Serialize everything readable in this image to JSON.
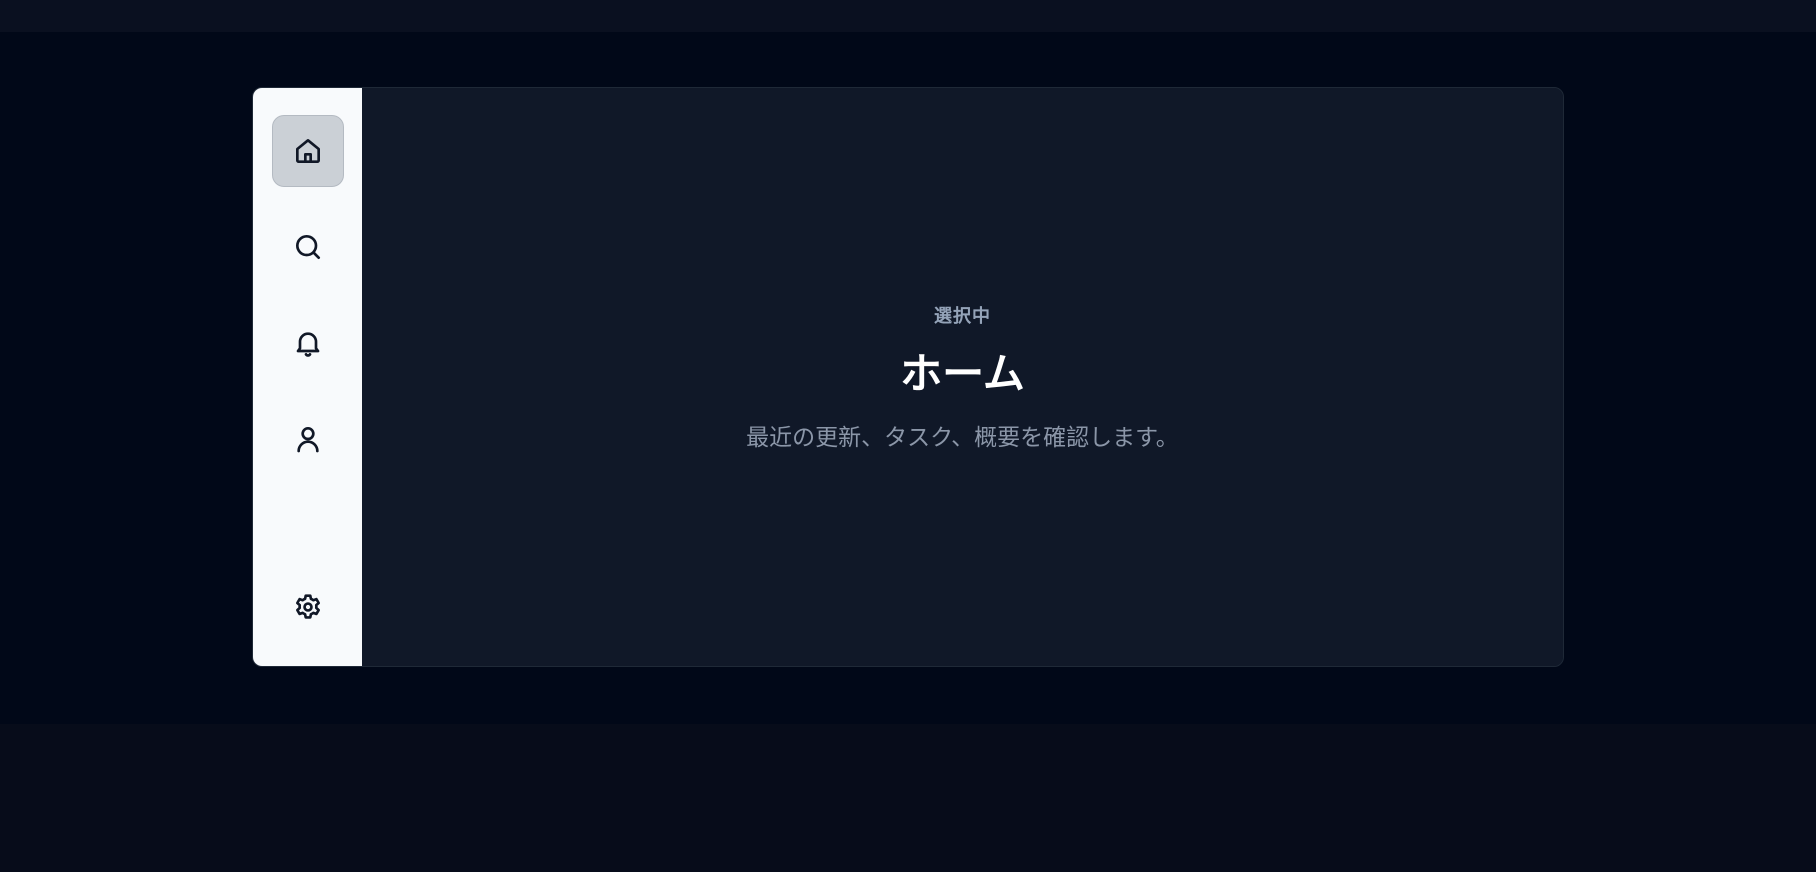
{
  "sidebar": {
    "items": [
      {
        "id": "home",
        "icon": "home-icon",
        "active": true
      },
      {
        "id": "search",
        "icon": "search-icon",
        "active": false
      },
      {
        "id": "notifications",
        "icon": "bell-icon",
        "active": false
      },
      {
        "id": "profile",
        "icon": "user-icon",
        "active": false
      },
      {
        "id": "settings",
        "icon": "gear-icon",
        "active": false
      }
    ]
  },
  "main": {
    "eyebrow": "選択中",
    "title": "ホーム",
    "description": "最近の更新、タスク、概要を確認します。"
  },
  "colors": {
    "background": "#010818",
    "sidebar": "#f8fafc",
    "panel": "#101828",
    "active_item": "#cbd0d6",
    "title": "#ffffff",
    "muted": "#94a3b8"
  }
}
